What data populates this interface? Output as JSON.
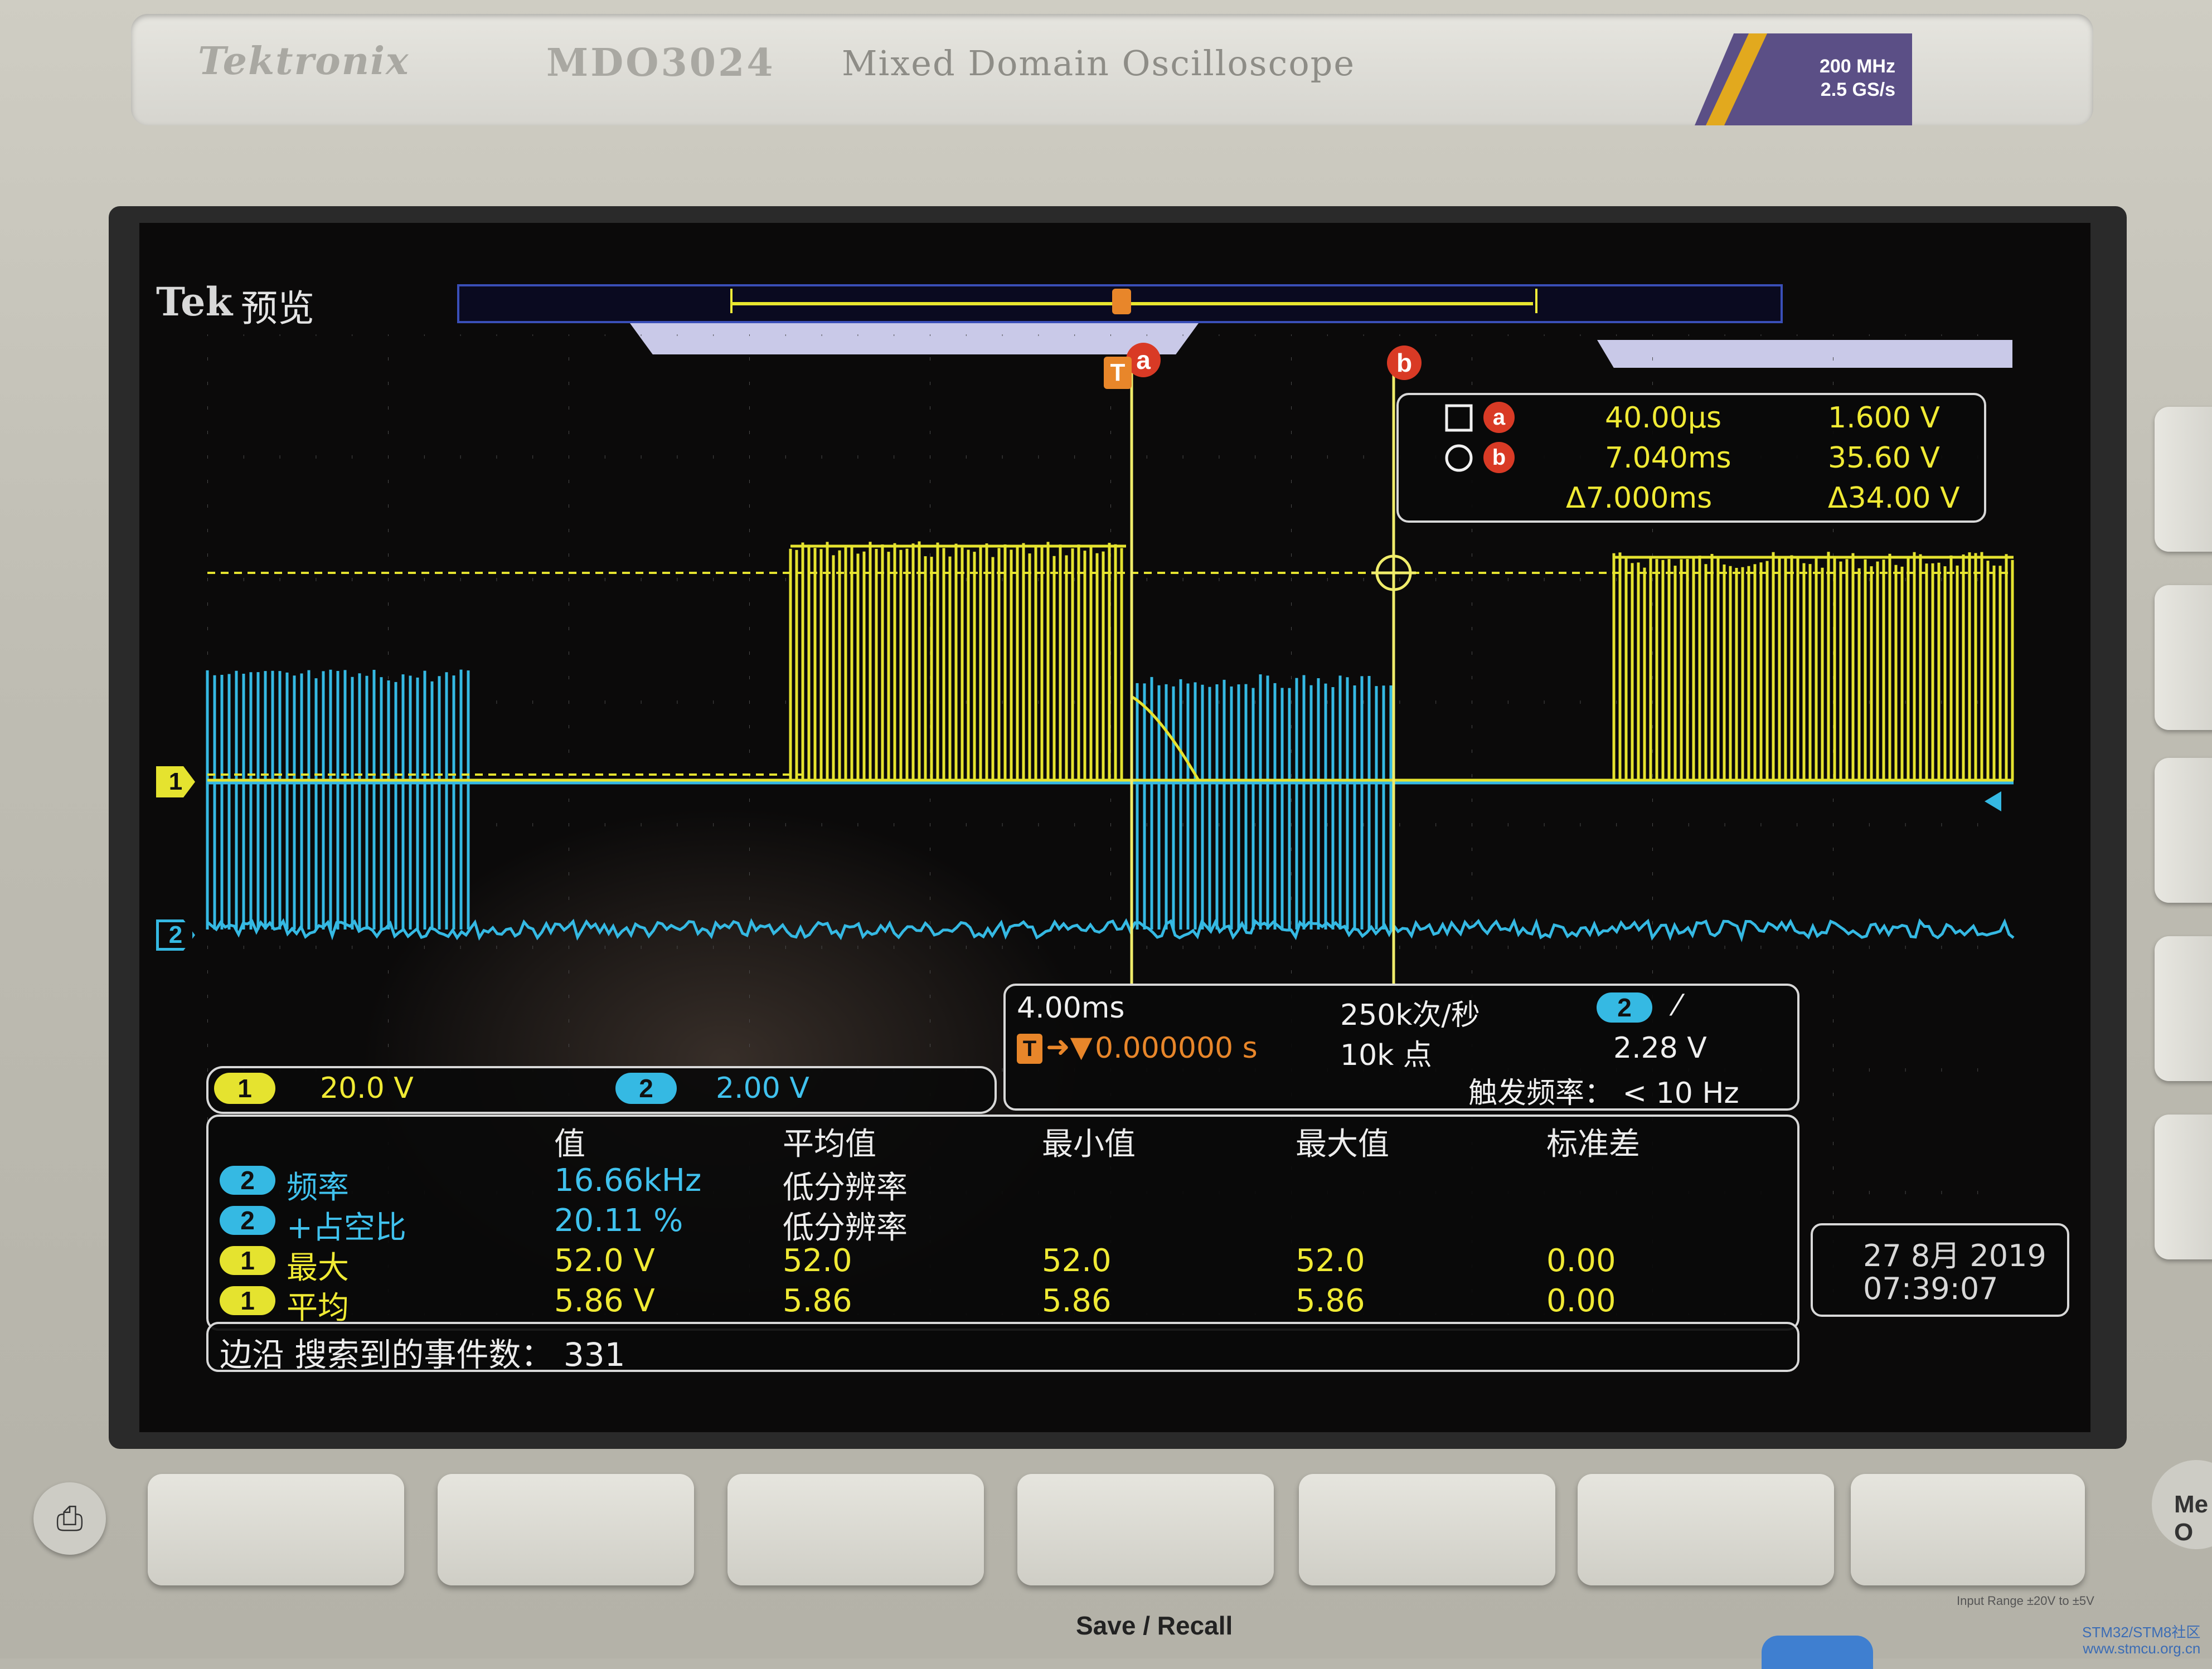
{
  "brand": {
    "logo": "Tektronix",
    "model": "MDO3024",
    "title": "Mixed Domain Oscilloscope",
    "spec_line1": "200 MHz",
    "spec_line2": "2.5 GS/s"
  },
  "screen": {
    "tek": "Tek",
    "mode": "预览",
    "ch1_marker": "1",
    "ch2_marker": "2",
    "trigger_marker": "T",
    "cursor_a_flag": "a",
    "cursor_b_flag": "b",
    "colors": {
      "ch1": "#e5e32f",
      "ch2": "#35b9e3",
      "cursor": "#d93a25",
      "trigger": "#e8862a"
    }
  },
  "cursor_readout": {
    "rows": [
      {
        "icon": "square",
        "flag": "a",
        "time": "40.00µs",
        "value": "1.600 V"
      },
      {
        "icon": "circle",
        "flag": "b",
        "time": "7.040ms",
        "value": "35.60 V"
      },
      {
        "icon": "",
        "flag": "",
        "time": "Δ7.000ms",
        "value": "Δ34.00 V"
      }
    ]
  },
  "timebase": {
    "scale": "4.00ms",
    "sample_rate": "250k次/秒",
    "trigger_channel": "2",
    "trigger_slope": "⁄",
    "position": "0.000000 s",
    "record_length": "10k 点",
    "trigger_level": "2.28 V",
    "trigger_freq": "触发频率： < 10 Hz"
  },
  "channel_scales": {
    "ch1_label": "1",
    "ch1": "20.0 V",
    "ch2_label": "2",
    "ch2": "2.00 V"
  },
  "measurements": {
    "headers": [
      "值",
      "平均值",
      "最小值",
      "最大值",
      "标准差"
    ],
    "rows": [
      {
        "ch": "2",
        "name": "频率",
        "value": "16.66kHz",
        "mean": "低分辨率",
        "min": "",
        "max": "",
        "std": ""
      },
      {
        "ch": "2",
        "name": "+占空比",
        "value": "20.11 %",
        "mean": "低分辨率",
        "min": "",
        "max": "",
        "std": ""
      },
      {
        "ch": "1",
        "name": "最大",
        "value": "52.0 V",
        "mean": "52.0",
        "min": "52.0",
        "max": "52.0",
        "std": "0.00"
      },
      {
        "ch": "1",
        "name": "平均",
        "value": "5.86 V",
        "mean": "5.86",
        "min": "5.86",
        "max": "5.86",
        "std": "0.00"
      }
    ]
  },
  "status": {
    "text": "边沿 搜索到的事件数： 331"
  },
  "datetime": {
    "date": "27 8月 2019",
    "time": "07:39:07"
  },
  "panel": {
    "save_recall": "Save / Recall",
    "menu": "Me\nO",
    "input_range": "Input Range ±20V to ±5V"
  },
  "watermark": {
    "line1": "STM32/STM8社区",
    "line2": "www.stmcu.org.cn"
  }
}
